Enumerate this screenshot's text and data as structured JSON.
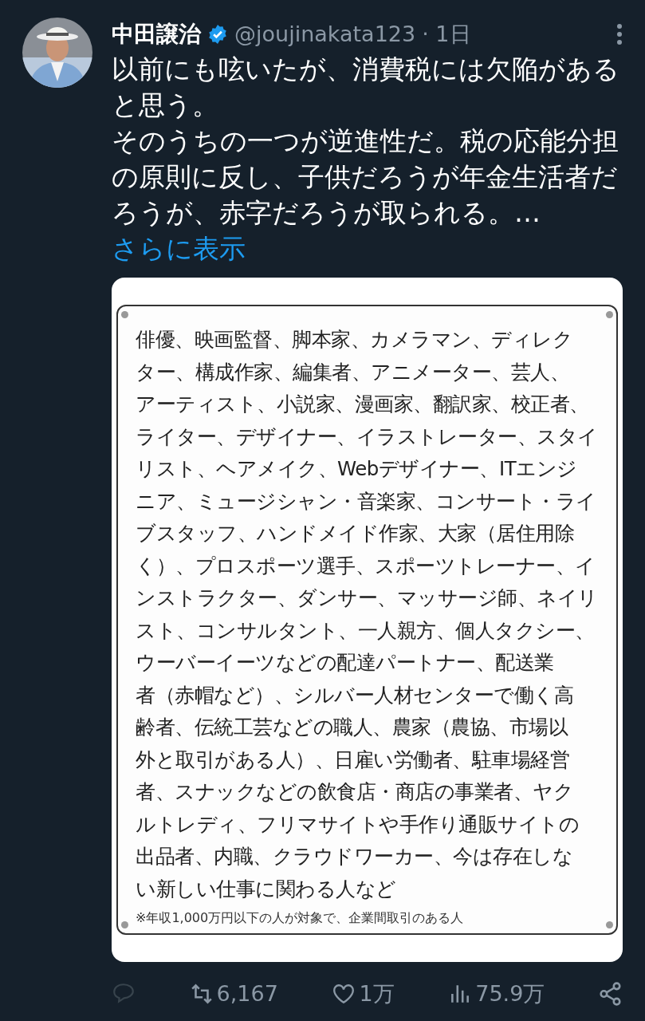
{
  "author": {
    "name": "中田譲治",
    "verified": true,
    "handle": "@joujinakata123",
    "time": "· 1日"
  },
  "tweet": {
    "paragraphs": [
      "以前にも呟いたが、消費税には欠陥があると思う。",
      "そのうちの一つが逆進性だ。税の応能分担の原則に反し、子供だろうが年金生活者だろうが、赤字だろうが取られる。…"
    ],
    "more_link": "さらに表示"
  },
  "document": {
    "lines": [
      "俳優、映画監督、脚本家、カメラマン、ディレク",
      "ター、構成作家、編集者、アニメーター、芸人、",
      "アーティスト、小説家、漫画家、翻訳家、校正者、",
      "ライター、デザイナー、イラストレーター、スタイ",
      "リスト、ヘアメイク、Webデザイナー、ITエンジ",
      "ニア、ミュージシャン・音楽家、コンサート・ライ",
      "ブスタッフ、ハンドメイド作家、大家（居住用除",
      "く）、プロスポーツ選手、スポーツトレーナー、イ",
      "ンストラクター、ダンサー、マッサージ師、ネイリ",
      "スト、コンサルタント、一人親方、個人タクシー、",
      "ウーバーイーツなどの配達パートナー、配送業",
      "者（赤帽など）、シルバー人材センターで働く高",
      "齢者、伝統工芸などの職人、農家（農協、市場以",
      "外と取引がある人）、日雇い労働者、駐車場経営",
      "者、スナックなどの飲食店・商店の事業者、ヤク",
      "ルトレディ、フリマサイトや手作り通販サイトの",
      "出品者、内職、クラウドワーカー、今は存在しな",
      "い新しい仕事に関わる人など"
    ],
    "note": "※年収1,000万円以下の人が対象で、企業間取引のある人"
  },
  "actions": [
    {
      "kind": "reply",
      "disabled": true
    },
    {
      "kind": "retweet",
      "count": "6,167"
    },
    {
      "kind": "like",
      "count": "1万"
    },
    {
      "kind": "views",
      "count": "75.9万"
    },
    {
      "kind": "share"
    }
  ]
}
